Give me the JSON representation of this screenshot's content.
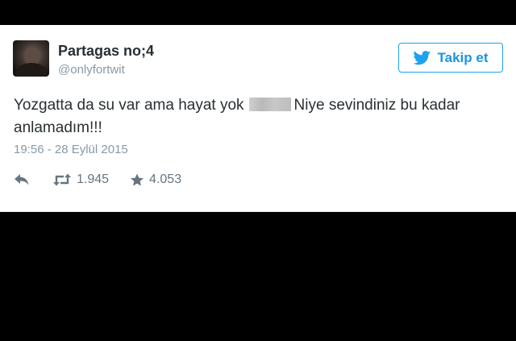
{
  "tweet": {
    "user": {
      "name": "Partagas no;4",
      "handle": "@onlyfortwit"
    },
    "follow_button": {
      "label": "Takip et",
      "icon": "twitter-bird-icon",
      "color": "#1da1f2"
    },
    "text": {
      "part1": "Yozgatta da su var ama hayat yok",
      "part2": "Niye sevindiniz bu kadar anlamadım!!!"
    },
    "timestamp": "19:56 - 28 Eylül 2015",
    "actions": {
      "reply": {
        "icon": "reply-icon"
      },
      "retweet": {
        "icon": "retweet-icon",
        "count": "1.945"
      },
      "favorite": {
        "icon": "star-icon",
        "count": "4.053"
      }
    }
  }
}
